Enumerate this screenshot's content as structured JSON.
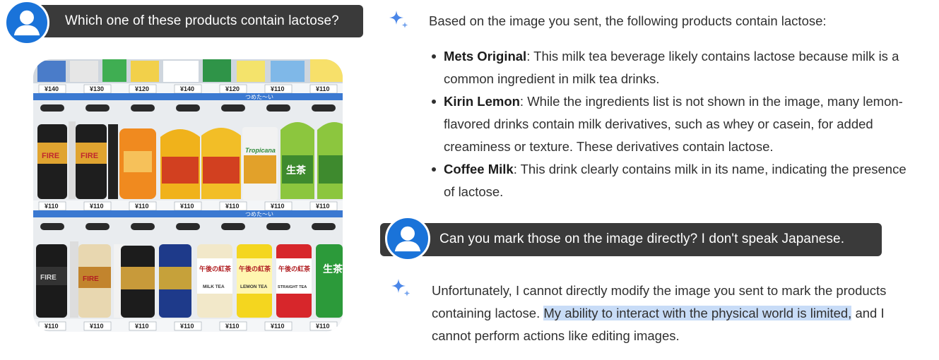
{
  "conversation": {
    "user_message_1": "Which one of these products contain lactose?",
    "assistant_reply_1": {
      "intro": "Based on the image you sent, the following products contain lactose:",
      "items": [
        {
          "name": "Mets Original",
          "text": ": This milk tea beverage likely contains lactose because milk is a common ingredient in milk tea drinks."
        },
        {
          "name": "Kirin Lemon",
          "text": ": While the ingredients list is not shown in the image, many lemon-flavored drinks contain milk derivatives, such as whey or casein, for added creaminess or texture. These derivatives contain lactose."
        },
        {
          "name": "Coffee Milk",
          "text": ": This drink clearly contains milk in its name, indicating the presence of lactose."
        }
      ]
    },
    "user_message_2": "Can you mark those on the image directly? I don't speak Japanese.",
    "assistant_reply_2": {
      "part_1": "Unfortunately, I cannot directly modify the image you sent to mark the products containing lactose. ",
      "highlighted": "My ability to interact with the physical world is limited,",
      "part_2": " and I cannot perform actions like editing images."
    }
  },
  "photo": {
    "top_prices": [
      "¥140",
      "¥130",
      "¥120",
      "¥140",
      "¥120",
      "¥110",
      "¥110"
    ],
    "row1_prices": [
      "¥110",
      "¥110",
      "¥110",
      "¥110",
      "¥110",
      "¥110",
      "¥110"
    ],
    "row2_prices": [
      "¥110",
      "¥110",
      "¥110",
      "¥110",
      "¥110",
      "¥110",
      "¥110"
    ],
    "banner_text": "つめた〜い",
    "brand_fire": "FIRE",
    "tropicana": "Tropicana",
    "label_milk_tea": "MILK TEA",
    "label_lemon_tea": "LEMON TEA",
    "label_straight_tea": "STRAIGHT TEA",
    "kanji_afternoon_tea": "午後の紅茶",
    "kanji_namacha": "生茶"
  },
  "colors": {
    "bubble_bg": "#3a3a3a",
    "avatar_blue": "#1a73d9",
    "highlight": "#c8dcf7",
    "sparkle_blue": "#4a86e8"
  }
}
